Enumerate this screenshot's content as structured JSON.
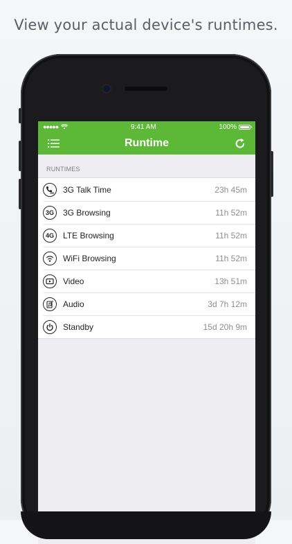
{
  "headline": "View your actual device's runtimes.",
  "status_bar": {
    "signal": "●●●●●",
    "time": "9:41 AM",
    "battery_pct": "100%",
    "battery_level": 1.0
  },
  "nav": {
    "title": "Runtime",
    "left_icon": "menu-list-icon",
    "right_icon": "refresh-icon"
  },
  "section": {
    "header": "RUNTIMES"
  },
  "rows": [
    {
      "icon": "phone-3g-icon",
      "label": "3G Talk Time",
      "value": "23h 45m"
    },
    {
      "icon": "3g-icon",
      "label": "3G Browsing",
      "value": "11h 52m",
      "badge": "3G"
    },
    {
      "icon": "4g-icon",
      "label": "LTE Browsing",
      "value": "11h 52m",
      "badge": "4G"
    },
    {
      "icon": "wifi-icon",
      "label": "WiFi Browsing",
      "value": "11h 52m"
    },
    {
      "icon": "video-icon",
      "label": "Video",
      "value": "13h 51m"
    },
    {
      "icon": "audio-icon",
      "label": "Audio",
      "value": "3d 7h 12m"
    },
    {
      "icon": "power-icon",
      "label": "Standby",
      "value": "15d 20h 9m"
    }
  ],
  "colors": {
    "accent": "#5cb836",
    "background": "#eeeef2"
  }
}
